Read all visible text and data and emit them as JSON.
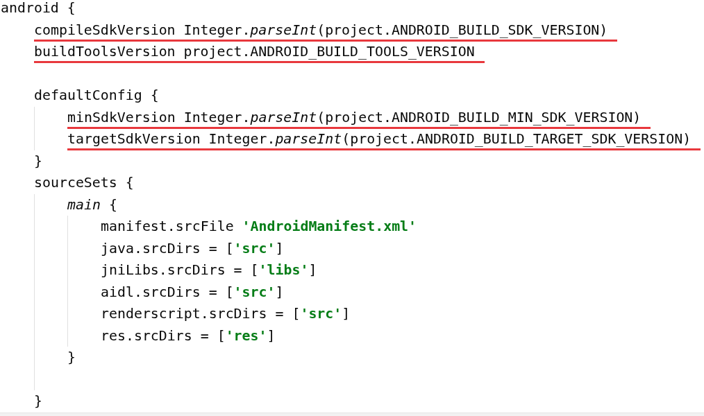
{
  "code": {
    "kind": "block",
    "open": [
      {
        "text": "android {",
        "kind": "plain"
      }
    ],
    "children": [
      {
        "kind": "line",
        "underlined": true,
        "tokens": [
          {
            "text": "compileSdkVersion Integer.",
            "kind": "plain"
          },
          {
            "text": "parseInt",
            "kind": "method"
          },
          {
            "text": "(project.ANDROID_BUILD_SDK_VERSION)",
            "kind": "plain"
          }
        ]
      },
      {
        "kind": "line",
        "underlined": true,
        "tokens": [
          {
            "text": "buildToolsVersion project.ANDROID_BUILD_TOOLS_VERSION",
            "kind": "plain"
          }
        ]
      },
      {
        "kind": "blank"
      },
      {
        "kind": "block",
        "open": [
          {
            "text": "defaultConfig {",
            "kind": "plain"
          }
        ],
        "close": [
          {
            "text": "}",
            "kind": "plain"
          }
        ],
        "children": [
          {
            "kind": "line",
            "underlined": true,
            "tokens": [
              {
                "text": "minSdkVersion Integer.",
                "kind": "plain"
              },
              {
                "text": "parseInt",
                "kind": "method"
              },
              {
                "text": "(project.ANDROID_BUILD_MIN_SDK_VERSION)",
                "kind": "plain"
              }
            ]
          },
          {
            "kind": "line",
            "underlined": true,
            "tokens": [
              {
                "text": "targetSdkVersion Integer.",
                "kind": "plain"
              },
              {
                "text": "parseInt",
                "kind": "method"
              },
              {
                "text": "(project.ANDROID_BUILD_TARGET_SDK_VERSION)",
                "kind": "plain"
              }
            ]
          }
        ]
      },
      {
        "kind": "block",
        "open": [
          {
            "text": "sourceSets {",
            "kind": "plain"
          }
        ],
        "close": [
          {
            "text": "}",
            "kind": "plain"
          }
        ],
        "children": [
          {
            "kind": "block",
            "open": [
              {
                "text": "main",
                "kind": "method"
              },
              {
                "text": " {",
                "kind": "plain"
              }
            ],
            "close": [
              {
                "text": "}",
                "kind": "plain"
              }
            ],
            "children": [
              {
                "kind": "line",
                "underlined": false,
                "tokens": [
                  {
                    "text": "manifest.srcFile ",
                    "kind": "plain"
                  },
                  {
                    "text": "'AndroidManifest.xml'",
                    "kind": "string"
                  }
                ]
              },
              {
                "kind": "line",
                "underlined": false,
                "tokens": [
                  {
                    "text": "java.srcDirs = [",
                    "kind": "plain"
                  },
                  {
                    "text": "'src'",
                    "kind": "string"
                  },
                  {
                    "text": "]",
                    "kind": "plain"
                  }
                ]
              },
              {
                "kind": "line",
                "underlined": false,
                "tokens": [
                  {
                    "text": "jniLibs.srcDirs = [",
                    "kind": "plain"
                  },
                  {
                    "text": "'libs'",
                    "kind": "string"
                  },
                  {
                    "text": "]",
                    "kind": "plain"
                  }
                ]
              },
              {
                "kind": "line",
                "underlined": false,
                "tokens": [
                  {
                    "text": "aidl.srcDirs = [",
                    "kind": "plain"
                  },
                  {
                    "text": "'src'",
                    "kind": "string"
                  },
                  {
                    "text": "]",
                    "kind": "plain"
                  }
                ]
              },
              {
                "kind": "line",
                "underlined": false,
                "tokens": [
                  {
                    "text": "renderscript.srcDirs = [",
                    "kind": "plain"
                  },
                  {
                    "text": "'src'",
                    "kind": "string"
                  },
                  {
                    "text": "]",
                    "kind": "plain"
                  }
                ]
              },
              {
                "kind": "line",
                "underlined": false,
                "tokens": [
                  {
                    "text": "res.srcDirs = [",
                    "kind": "plain"
                  },
                  {
                    "text": "'res'",
                    "kind": "string"
                  },
                  {
                    "text": "]",
                    "kind": "plain"
                  }
                ]
              }
            ]
          },
          {
            "kind": "blank"
          }
        ]
      }
    ]
  }
}
